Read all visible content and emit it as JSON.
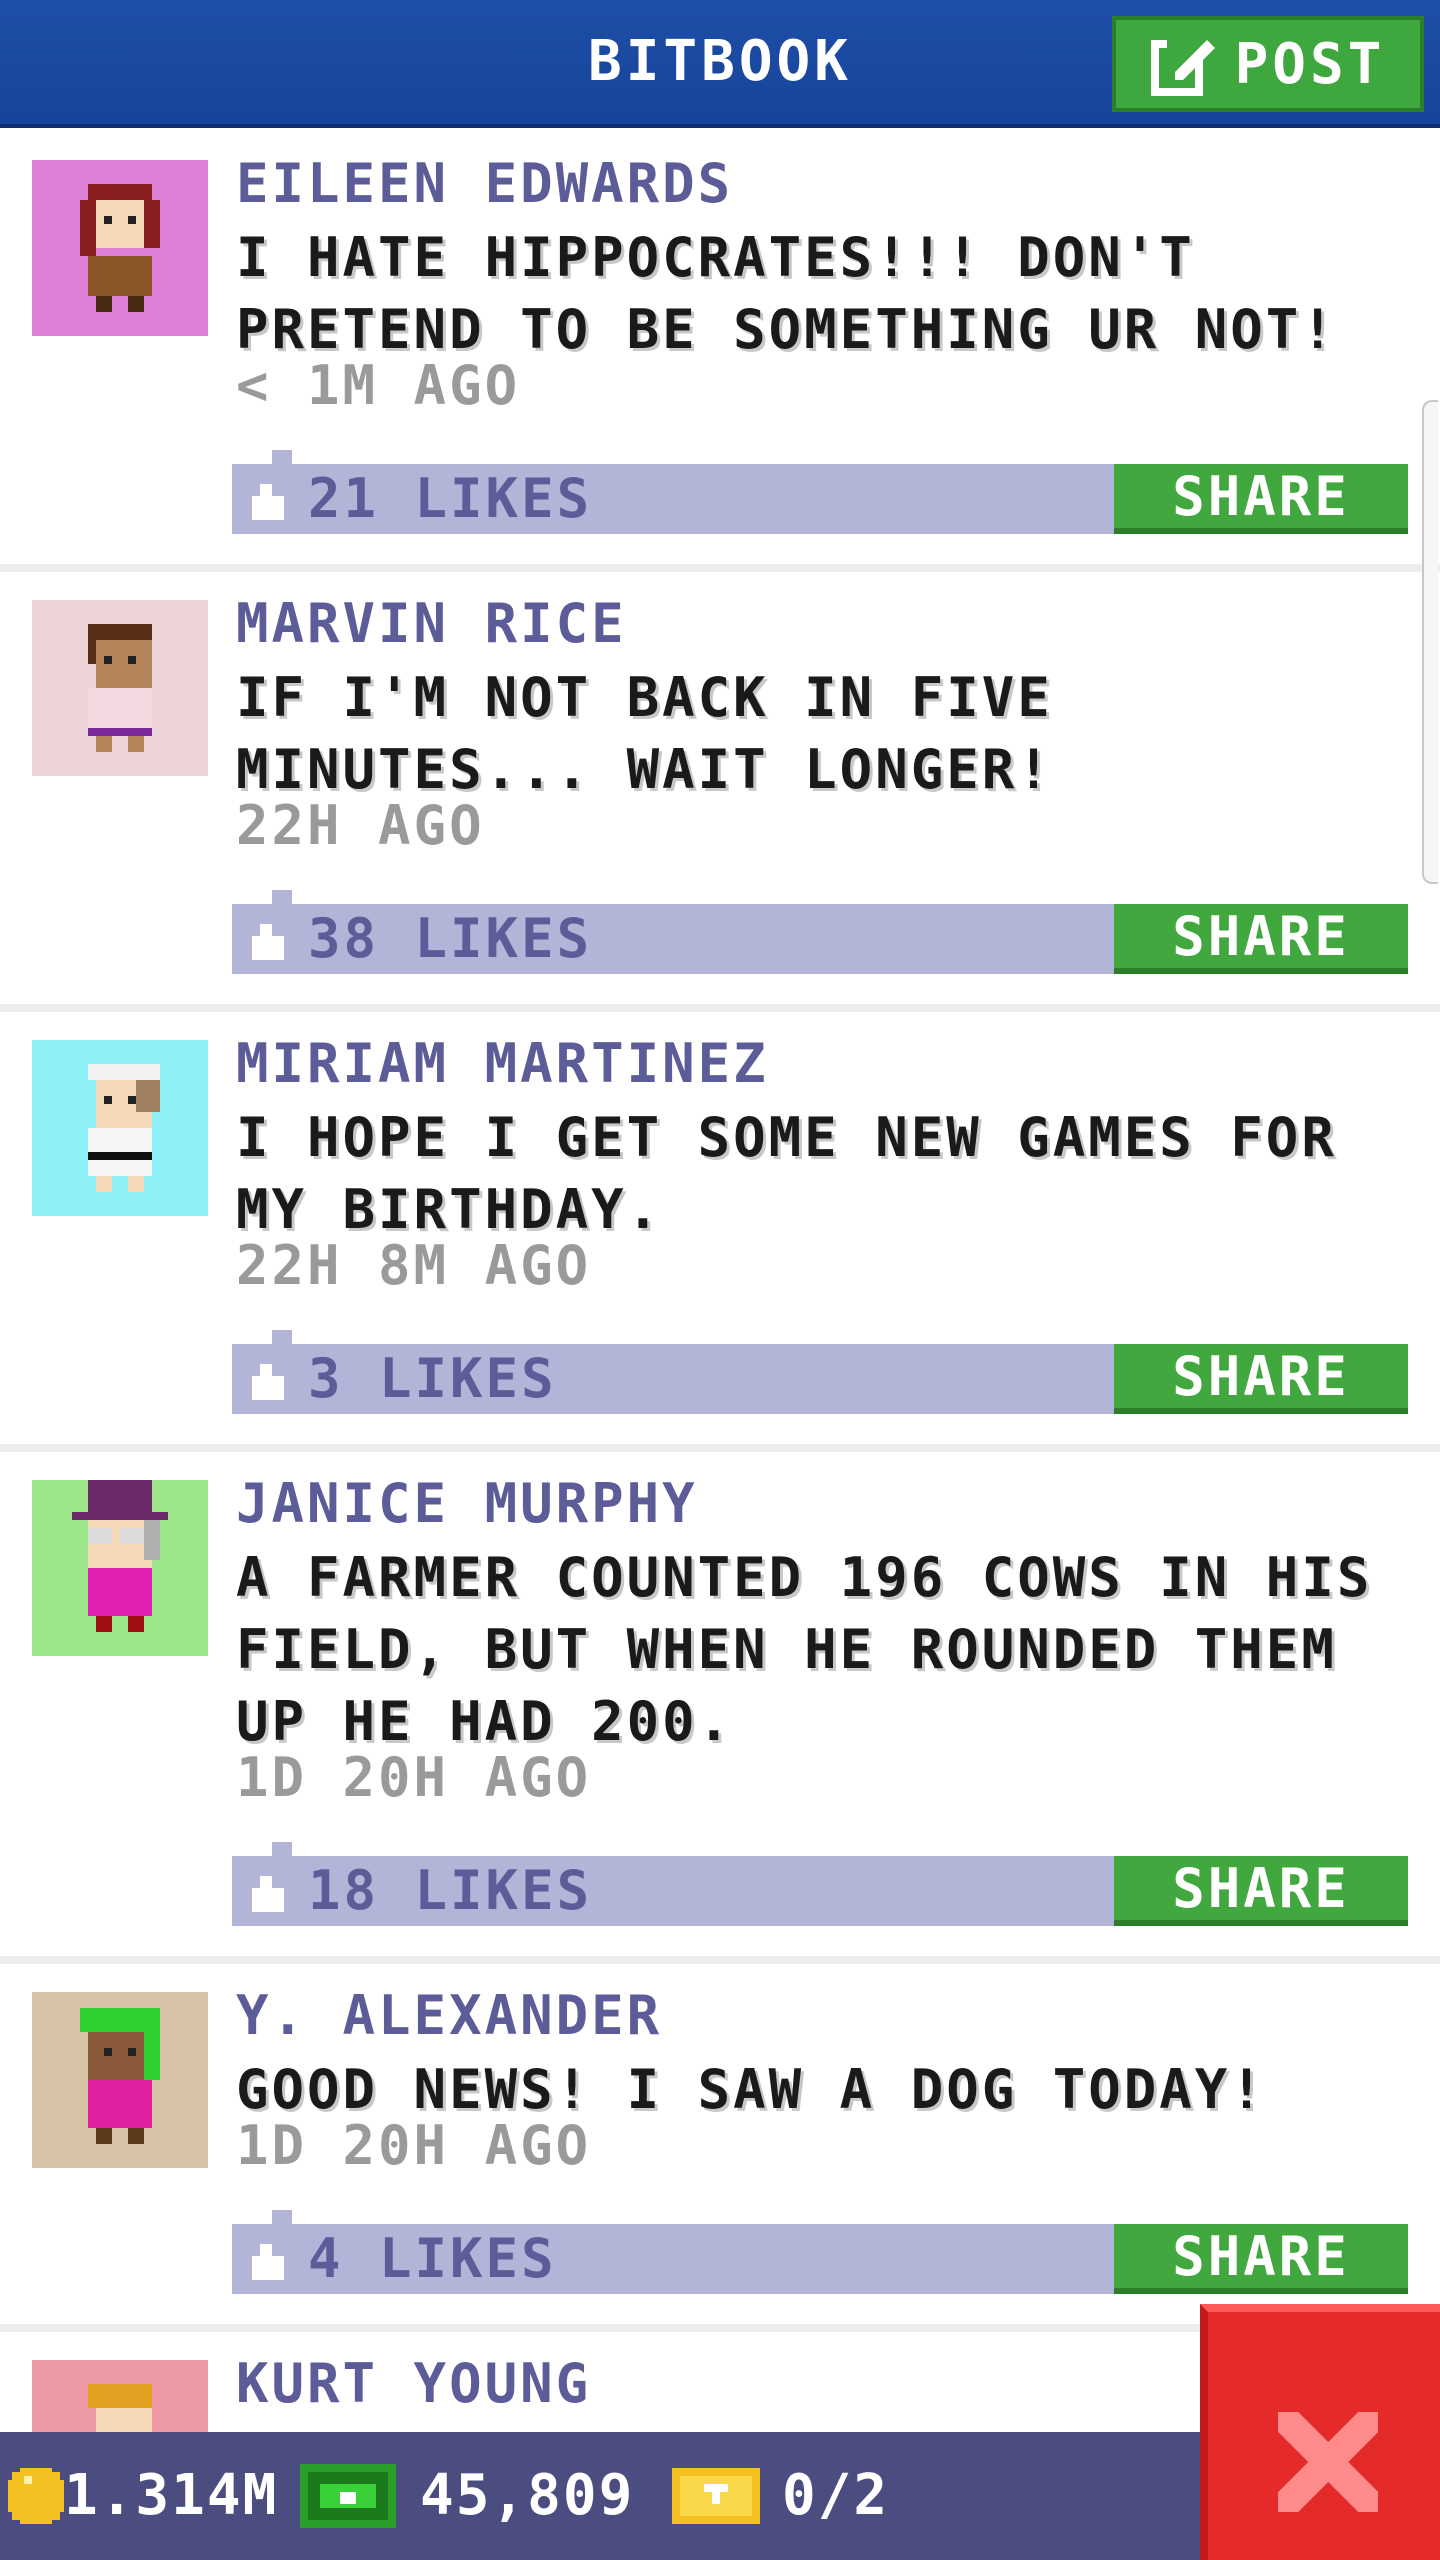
{
  "header": {
    "title": "BITBOOK",
    "post_label": "POST"
  },
  "posts": [
    {
      "author": "EILEEN EDWARDS",
      "text": "I HATE HIPPOCRATES!!! DON'T PRETEND TO BE SOMETHING UR NOT!",
      "time": "< 1M AGO",
      "likes": "21 LIKES",
      "share": "SHARE",
      "avatar_bg": "#e07fd6"
    },
    {
      "author": "MARVIN RICE",
      "text": "IF I'M NOT BACK IN FIVE MINUTES... WAIT LONGER!",
      "time": "22H AGO",
      "likes": "38 LIKES",
      "share": "SHARE",
      "avatar_bg": "#ecd4d8"
    },
    {
      "author": "MIRIAM MARTINEZ",
      "text": "I HOPE I GET SOME NEW GAMES FOR MY BIRTHDAY.",
      "time": "22H 8M AGO",
      "likes": "3 LIKES",
      "share": "SHARE",
      "avatar_bg": "#8ff1f7"
    },
    {
      "author": "JANICE MURPHY",
      "text": "A FARMER COUNTED 196 COWS IN HIS FIELD, BUT WHEN HE ROUNDED THEM UP HE HAD 200.",
      "time": "1D 20H AGO",
      "likes": "18 LIKES",
      "share": "SHARE",
      "avatar_bg": "#9de58a"
    },
    {
      "author": "Y. ALEXANDER",
      "text": "GOOD NEWS! I SAW A DOG TODAY!",
      "time": "1D 20H AGO",
      "likes": "4 LIKES",
      "share": "SHARE",
      "avatar_bg": "#d8c2a6"
    },
    {
      "author": "KURT YOUNG",
      "avatar_bg": "#ee9aa6"
    }
  ],
  "status": {
    "coins": "1.314M",
    "bux": "45,809",
    "tickets": "0/2"
  },
  "colors": {
    "header": "#1f4ea8",
    "accent_green": "#3ea83e",
    "likes_bar": "#b3b5d8",
    "author_text": "#5c5c98",
    "bottom_bar": "#4b4d80",
    "close_red": "#e52a2a"
  },
  "icons": {
    "post": "edit-icon",
    "like": "thumbs-up-icon",
    "coin": "coin-icon",
    "bux": "bux-icon",
    "ticket": "ticket-icon",
    "close": "close-icon"
  }
}
